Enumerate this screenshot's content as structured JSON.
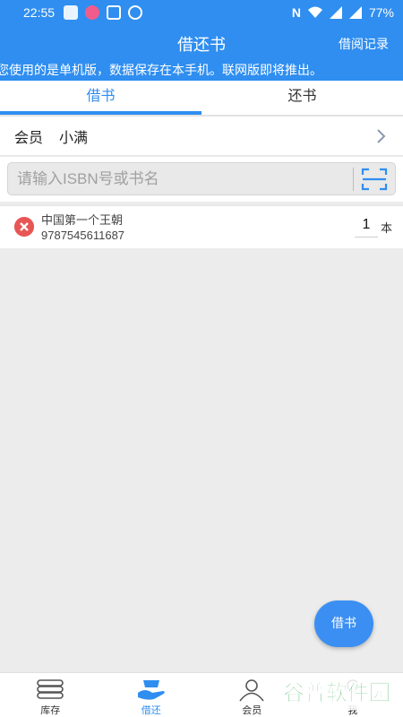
{
  "status_bar": {
    "time": "22:55",
    "battery": "77%"
  },
  "app_bar": {
    "title": "借还书",
    "history_label": "借阅记录"
  },
  "notice": "您使用的是单机版，数据保存在本手机。联网版即将推出。",
  "tabs": [
    {
      "label": "借书",
      "active": true
    },
    {
      "label": "还书",
      "active": false
    }
  ],
  "member": {
    "label": "会员",
    "name": "小满"
  },
  "search": {
    "placeholder": "请输入ISBN号或书名"
  },
  "books": [
    {
      "title": "中国第一个王朝",
      "isbn": "9787545611687",
      "quantity": "1",
      "unit": "本"
    }
  ],
  "fab_label": "借书",
  "bottom_nav": [
    {
      "label": "库存",
      "icon": "books-stack-icon",
      "active": false
    },
    {
      "label": "借还",
      "icon": "hand-book-icon",
      "active": true
    },
    {
      "label": "会员",
      "icon": "person-icon",
      "active": false
    },
    {
      "label": "我",
      "icon": "me-icon",
      "active": false
    }
  ],
  "watermark": "谷普软件园",
  "colors": {
    "primary": "#2f8ef0",
    "delete": "#e85555",
    "watermark_green": "#2aa84a"
  }
}
